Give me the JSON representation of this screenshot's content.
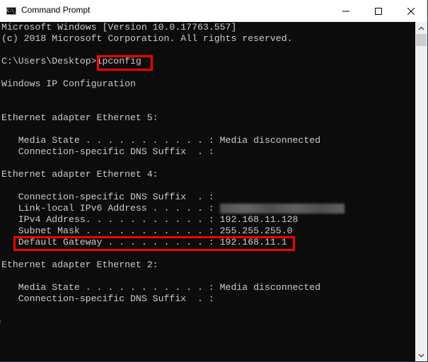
{
  "window": {
    "title": "Command Prompt",
    "icon": "console-icon",
    "icon_text": "C:\\_",
    "controls": {
      "minimize": "minimize-icon",
      "maximize": "maximize-icon",
      "close": "close-icon"
    }
  },
  "console": {
    "lines": [
      "Microsoft Windows [Version 10.0.17763.557]",
      "(c) 2018 Microsoft Corporation. All rights reserved.",
      "",
      "C:\\Users\\Desktop>ipconfig",
      "",
      "Windows IP Configuration",
      "",
      "",
      "Ethernet adapter Ethernet 5:",
      "",
      "   Media State . . . . . . . . . . . : Media disconnected",
      "   Connection-specific DNS Suffix  . :",
      "",
      "Ethernet adapter Ethernet 4:",
      "",
      "   Connection-specific DNS Suffix  . :",
      "   Link-local IPv6 Address . . . . . :",
      "   IPv4 Address. . . . . . . . . . . : 192.168.11.128",
      "   Subnet Mask . . . . . . . . . . . : 255.255.255.0",
      "   Default Gateway . . . . . . . . . : 192.168.11.1",
      "",
      "Ethernet adapter Ethernet 2:",
      "",
      "   Media State . . . . . . . . . . . : Media disconnected",
      "   Connection-specific DNS Suffix  . :"
    ],
    "prompt": "C:\\Users\\Desktop>",
    "command": "ipconfig",
    "ipv6_address": "[redacted/blurred]",
    "highlights": {
      "command": "ipconfig",
      "default_gateway": "192.168.11.1",
      "color": "#ff0000"
    }
  },
  "colors": {
    "console_bg": "#0c0c0c",
    "console_text": "#cccccc",
    "titlebar_bg": "#ffffff",
    "scrollbar_bg": "#f0f0f0",
    "highlight": "#ff0000"
  }
}
